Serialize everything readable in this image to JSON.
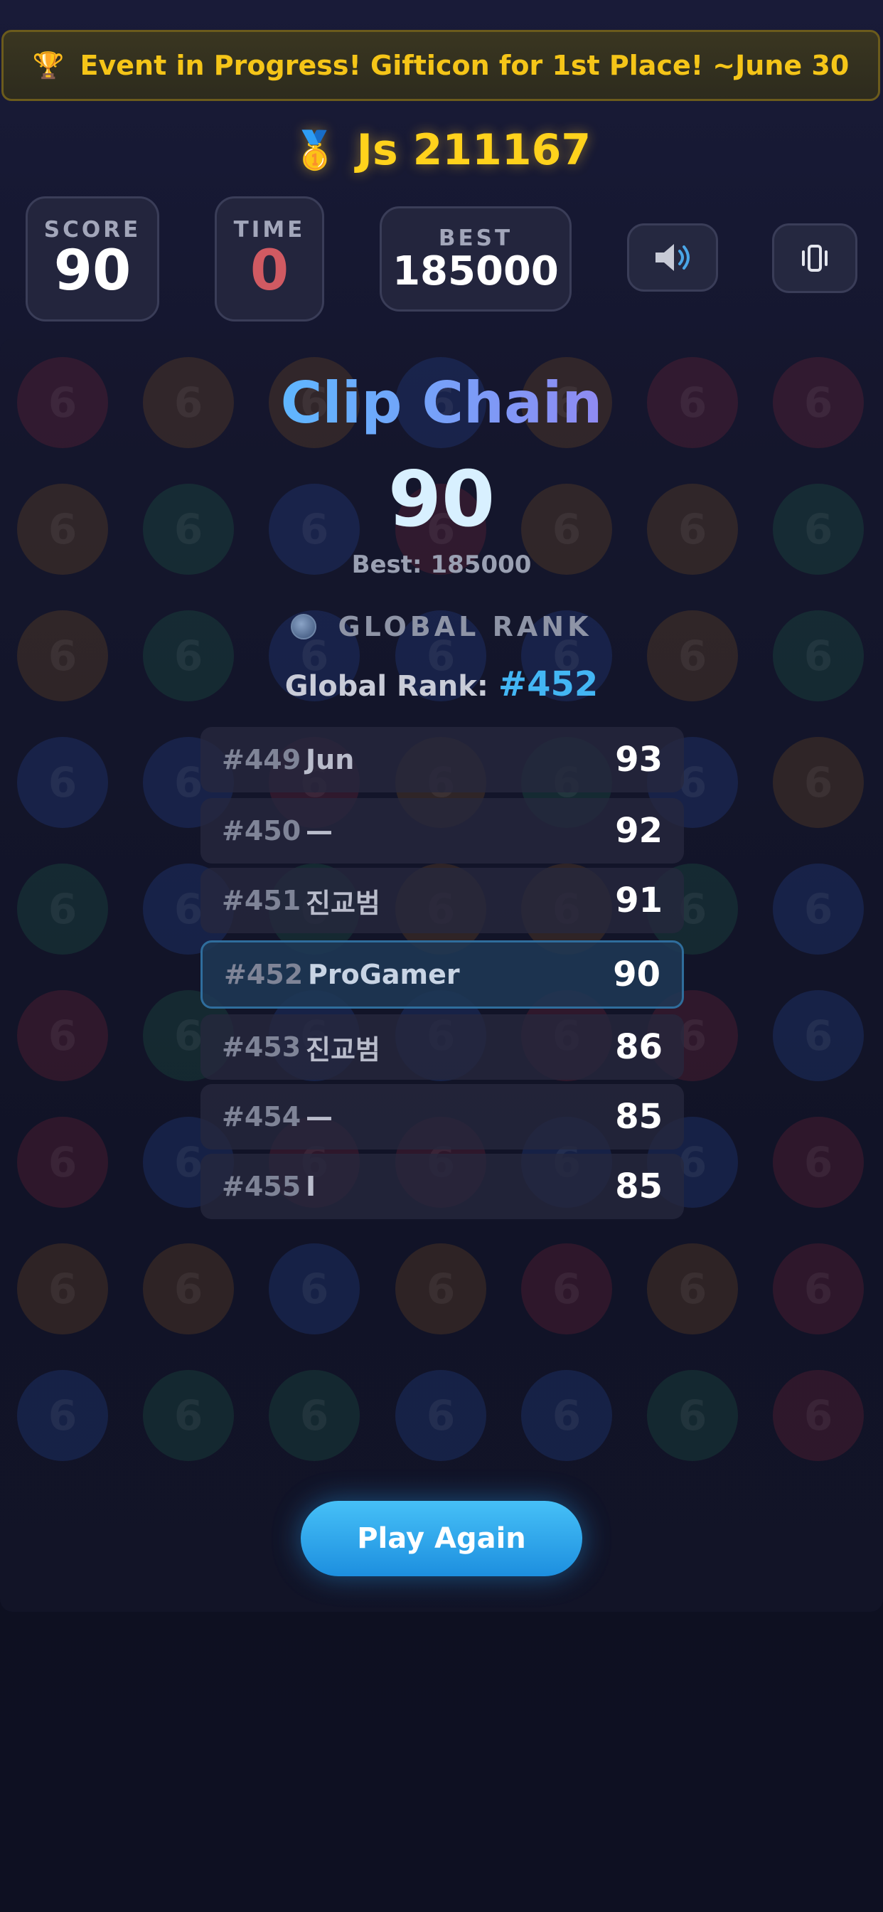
{
  "banner": {
    "icon": "trophy-icon",
    "text": "Event in Progress! Gifticon for 1st Place! ~June 30",
    "color": "#f5c518"
  },
  "player": {
    "icon": "medal-icon",
    "label": "Js 211167",
    "color": "#ffd21c"
  },
  "stats": {
    "score": {
      "label": "SCORE",
      "value": "90"
    },
    "time": {
      "label": "TIME",
      "value": "0",
      "color": "#d05a62"
    },
    "best": {
      "label": "BEST",
      "value": "185000"
    }
  },
  "controls": {
    "sound_icon": "speaker-icon",
    "vibrate_icon": "vibrate-icon"
  },
  "board": {
    "ball_label": "6"
  },
  "result": {
    "title": "Clip Chain",
    "score": "90",
    "best_text": "Best: 185000",
    "global_title": "GLOBAL RANK",
    "global_icon": "globe-icon",
    "rank_label": "Global Rank:",
    "rank_value": "#452",
    "accent": "#43b6f4"
  },
  "leaderboard": [
    {
      "rank": "#449",
      "name": "Jun",
      "score": "93",
      "current": false
    },
    {
      "rank": "#450",
      "name": "—",
      "score": "92",
      "current": false
    },
    {
      "rank": "#451",
      "name": "진교범",
      "score": "91",
      "current": false
    },
    {
      "rank": "#452",
      "name": "ProGamer",
      "score": "90",
      "current": true
    },
    {
      "rank": "#453",
      "name": "진교범",
      "score": "86",
      "current": false
    },
    {
      "rank": "#454",
      "name": "—",
      "score": "85",
      "current": false
    },
    {
      "rank": "#455",
      "name": "I",
      "score": "85",
      "current": false
    }
  ],
  "play_again": {
    "label": "Play Again",
    "color": "#1d8fdf"
  }
}
